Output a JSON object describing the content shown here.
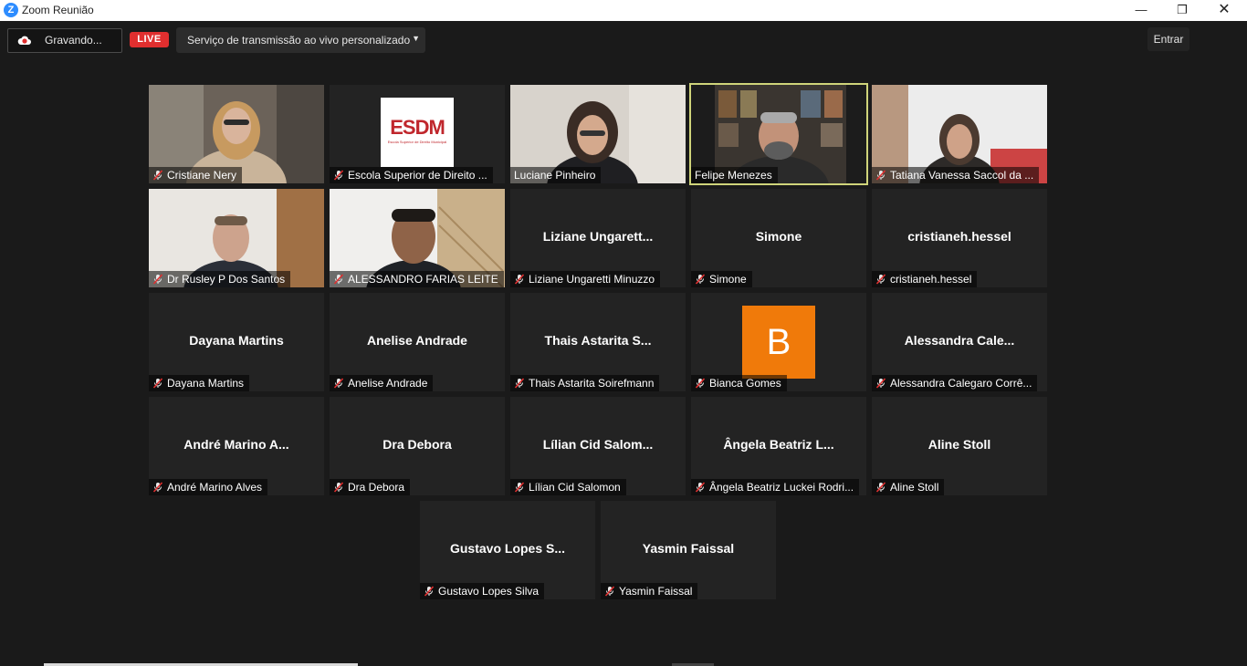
{
  "window": {
    "title": "Zoom Reunião",
    "logo_letter": "Z"
  },
  "toolbar": {
    "recording_label": "Gravando...",
    "live_badge": "LIVE",
    "stream_dropdown": "Serviço de transmissão ao vivo personalizado",
    "enter_button": "Entrar"
  },
  "colors": {
    "live": "#e02f2f",
    "active_speaker_border": "#cfd47a",
    "avatar_bg": "#f07a0a"
  },
  "participants": [
    {
      "label": "Cristiane Nery",
      "type": "video",
      "muted": true
    },
    {
      "label": "Escola Superior de Direito ...",
      "type": "logo",
      "muted": true,
      "logo_text": "ESDM",
      "logo_subtext": "Escola Superior de Direito Municipal"
    },
    {
      "label": "Luciane Pinheiro",
      "type": "video",
      "muted": false
    },
    {
      "label": "Felipe Menezes",
      "type": "video",
      "muted": false,
      "active": true
    },
    {
      "label": "Tatiana Vanessa Saccol da ...",
      "type": "video",
      "muted": true
    },
    {
      "label": "Dr Rusley P Dos Santos",
      "type": "video",
      "muted": true
    },
    {
      "label": "ALESSANDRO FARIAS LEITE",
      "type": "video",
      "muted": true
    },
    {
      "display_name": "Liziane  Ungarett...",
      "label": "Liziane Ungaretti Minuzzo",
      "type": "name",
      "muted": true
    },
    {
      "display_name": "Simone",
      "label": "Simone",
      "type": "name",
      "muted": true
    },
    {
      "display_name": "cristianeh.hessel",
      "label": "cristianeh.hessel",
      "type": "name",
      "muted": true
    },
    {
      "display_name": "Dayana Martins",
      "label": "Dayana Martins",
      "type": "name",
      "muted": true
    },
    {
      "display_name": "Anelise Andrade",
      "label": "Anelise Andrade",
      "type": "name",
      "muted": true
    },
    {
      "display_name": "Thais Astarita S...",
      "label": "Thais Astarita Soirefmann",
      "type": "name",
      "muted": true
    },
    {
      "avatar_letter": "B",
      "label": "Bianca Gomes",
      "type": "avatar",
      "muted": true
    },
    {
      "display_name": "Alessandra  Cale...",
      "label": "Alessandra Calegaro Corrê...",
      "type": "name",
      "muted": true
    },
    {
      "display_name": "André  Marino  A...",
      "label": "André Marino Alves",
      "type": "name",
      "muted": true
    },
    {
      "display_name": "Dra Debora",
      "label": "Dra Debora",
      "type": "name",
      "muted": true
    },
    {
      "display_name": "Lílian  Cid  Salom...",
      "label": "Lílian Cid Salomon",
      "type": "name",
      "muted": true
    },
    {
      "display_name": "Ângela Beatriz L...",
      "label": "Ângela Beatriz Luckei Rodri...",
      "type": "name",
      "muted": true
    },
    {
      "display_name": "Aline Stoll",
      "label": "Aline Stoll",
      "type": "name",
      "muted": true
    },
    {
      "display_name": "Gustavo Lopes S...",
      "label": "Gustavo Lopes Silva",
      "type": "name",
      "muted": true
    },
    {
      "display_name": "Yasmin Faissal",
      "label": "Yasmin Faissal",
      "type": "name",
      "muted": true
    }
  ]
}
